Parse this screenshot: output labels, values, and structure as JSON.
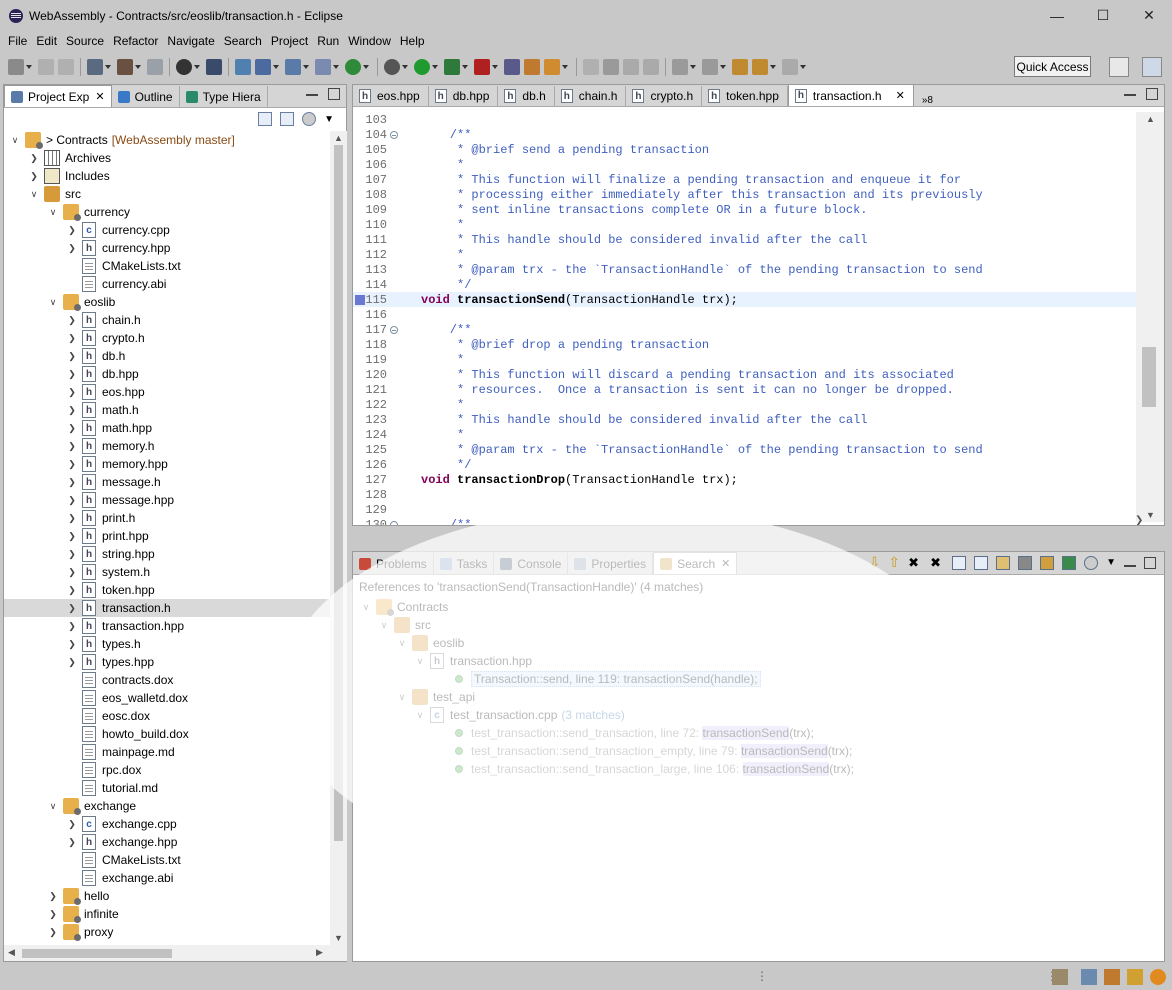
{
  "window": {
    "title": "WebAssembly - Contracts/src/eoslib/transaction.h - Eclipse"
  },
  "menu": [
    "File",
    "Edit",
    "Source",
    "Refactor",
    "Navigate",
    "Search",
    "Project",
    "Run",
    "Window",
    "Help"
  ],
  "toolbar": {
    "quick_access": "Quick Access"
  },
  "left_view": {
    "tabs": [
      "Project Exp",
      "Outline",
      "Type Hiera"
    ],
    "tree": [
      {
        "depth": 0,
        "twisty": "v",
        "icon": "project",
        "label": "> Contracts",
        "extra": "[WebAssembly master]"
      },
      {
        "depth": 1,
        "twisty": ">",
        "icon": "archive",
        "label": "Archives"
      },
      {
        "depth": 1,
        "twisty": ">",
        "icon": "includes",
        "label": "Includes"
      },
      {
        "depth": 1,
        "twisty": "v",
        "icon": "src",
        "label": "src"
      },
      {
        "depth": 2,
        "twisty": "v",
        "icon": "folder",
        "label": "currency"
      },
      {
        "depth": 3,
        "twisty": ">",
        "icon": "cfile",
        "label": "currency.cpp"
      },
      {
        "depth": 3,
        "twisty": ">",
        "icon": "hfile",
        "label": "currency.hpp"
      },
      {
        "depth": 3,
        "twisty": "",
        "icon": "txt",
        "label": "CMakeLists.txt"
      },
      {
        "depth": 3,
        "twisty": "",
        "icon": "txt",
        "label": "currency.abi"
      },
      {
        "depth": 2,
        "twisty": "v",
        "icon": "folder",
        "label": "eoslib"
      },
      {
        "depth": 3,
        "twisty": ">",
        "icon": "hfile",
        "label": "chain.h"
      },
      {
        "depth": 3,
        "twisty": ">",
        "icon": "hfile",
        "label": "crypto.h"
      },
      {
        "depth": 3,
        "twisty": ">",
        "icon": "hfile",
        "label": "db.h"
      },
      {
        "depth": 3,
        "twisty": ">",
        "icon": "hfile",
        "label": "db.hpp"
      },
      {
        "depth": 3,
        "twisty": ">",
        "icon": "hfile",
        "label": "eos.hpp"
      },
      {
        "depth": 3,
        "twisty": ">",
        "icon": "hfile",
        "label": "math.h"
      },
      {
        "depth": 3,
        "twisty": ">",
        "icon": "hfile",
        "label": "math.hpp"
      },
      {
        "depth": 3,
        "twisty": ">",
        "icon": "hfile",
        "label": "memory.h"
      },
      {
        "depth": 3,
        "twisty": ">",
        "icon": "hfile",
        "label": "memory.hpp"
      },
      {
        "depth": 3,
        "twisty": ">",
        "icon": "hfile",
        "label": "message.h"
      },
      {
        "depth": 3,
        "twisty": ">",
        "icon": "hfile",
        "label": "message.hpp"
      },
      {
        "depth": 3,
        "twisty": ">",
        "icon": "hfile",
        "label": "print.h"
      },
      {
        "depth": 3,
        "twisty": ">",
        "icon": "hfile",
        "label": "print.hpp"
      },
      {
        "depth": 3,
        "twisty": ">",
        "icon": "hfile",
        "label": "string.hpp"
      },
      {
        "depth": 3,
        "twisty": ">",
        "icon": "hfile",
        "label": "system.h"
      },
      {
        "depth": 3,
        "twisty": ">",
        "icon": "hfile",
        "label": "token.hpp"
      },
      {
        "depth": 3,
        "twisty": ">",
        "icon": "hfile",
        "label": "transaction.h",
        "selected": true
      },
      {
        "depth": 3,
        "twisty": ">",
        "icon": "hfile",
        "label": "transaction.hpp"
      },
      {
        "depth": 3,
        "twisty": ">",
        "icon": "hfile",
        "label": "types.h"
      },
      {
        "depth": 3,
        "twisty": ">",
        "icon": "hfile",
        "label": "types.hpp"
      },
      {
        "depth": 3,
        "twisty": "",
        "icon": "txt",
        "label": "contracts.dox"
      },
      {
        "depth": 3,
        "twisty": "",
        "icon": "txt",
        "label": "eos_walletd.dox"
      },
      {
        "depth": 3,
        "twisty": "",
        "icon": "txt",
        "label": "eosc.dox"
      },
      {
        "depth": 3,
        "twisty": "",
        "icon": "txt",
        "label": "howto_build.dox"
      },
      {
        "depth": 3,
        "twisty": "",
        "icon": "txt",
        "label": "mainpage.md"
      },
      {
        "depth": 3,
        "twisty": "",
        "icon": "txt",
        "label": "rpc.dox"
      },
      {
        "depth": 3,
        "twisty": "",
        "icon": "txt",
        "label": "tutorial.md"
      },
      {
        "depth": 2,
        "twisty": "v",
        "icon": "folder",
        "label": "exchange"
      },
      {
        "depth": 3,
        "twisty": ">",
        "icon": "cfile",
        "label": "exchange.cpp"
      },
      {
        "depth": 3,
        "twisty": ">",
        "icon": "hfile",
        "label": "exchange.hpp"
      },
      {
        "depth": 3,
        "twisty": "",
        "icon": "txt",
        "label": "CMakeLists.txt"
      },
      {
        "depth": 3,
        "twisty": "",
        "icon": "txt",
        "label": "exchange.abi"
      },
      {
        "depth": 2,
        "twisty": ">",
        "icon": "folder",
        "label": "hello"
      },
      {
        "depth": 2,
        "twisty": ">",
        "icon": "folder",
        "label": "infinite"
      },
      {
        "depth": 2,
        "twisty": ">",
        "icon": "folder",
        "label": "proxy"
      }
    ]
  },
  "editor": {
    "tabs": [
      "eos.hpp",
      "db.hpp",
      "db.h",
      "chain.h",
      "crypto.h",
      "token.hpp",
      "transaction.h"
    ],
    "active_tab": "transaction.h",
    "overflow": "»8",
    "lines": [
      {
        "n": "103",
        "fold": false,
        "text": ""
      },
      {
        "n": "104",
        "fold": true,
        "text": "    /**"
      },
      {
        "n": "105",
        "fold": false,
        "text": "     * @brief send a pending transaction"
      },
      {
        "n": "106",
        "fold": false,
        "text": "     *"
      },
      {
        "n": "107",
        "fold": false,
        "text": "     * This function will finalize a pending transaction and enqueue it for"
      },
      {
        "n": "108",
        "fold": false,
        "text": "     * processing either immediately after this transaction and its previously"
      },
      {
        "n": "109",
        "fold": false,
        "text": "     * sent inline transactions complete OR in a future block."
      },
      {
        "n": "110",
        "fold": false,
        "text": "     *"
      },
      {
        "n": "111",
        "fold": false,
        "text": "     * This handle should be considered invalid after the call"
      },
      {
        "n": "112",
        "fold": false,
        "text": "     *"
      },
      {
        "n": "113",
        "fold": false,
        "text": "     * @param trx - the `TransactionHandle` of the pending transaction to send"
      },
      {
        "n": "114",
        "fold": false,
        "text": "     */"
      },
      {
        "n": "115",
        "fold": false,
        "code": true,
        "kw": "void",
        "fn": "transactionSend",
        "rest": "(TransactionHandle trx);",
        "hl": true
      },
      {
        "n": "116",
        "fold": false,
        "text": ""
      },
      {
        "n": "117",
        "fold": true,
        "text": "    /**"
      },
      {
        "n": "118",
        "fold": false,
        "text": "     * @brief drop a pending transaction"
      },
      {
        "n": "119",
        "fold": false,
        "text": "     *"
      },
      {
        "n": "120",
        "fold": false,
        "text": "     * This function will discard a pending transaction and its associated"
      },
      {
        "n": "121",
        "fold": false,
        "text": "     * resources.  Once a transaction is sent it can no longer be dropped."
      },
      {
        "n": "122",
        "fold": false,
        "text": "     *"
      },
      {
        "n": "123",
        "fold": false,
        "text": "     * This handle should be considered invalid after the call"
      },
      {
        "n": "124",
        "fold": false,
        "text": "     *"
      },
      {
        "n": "125",
        "fold": false,
        "text": "     * @param trx - the `TransactionHandle` of the pending transaction to send"
      },
      {
        "n": "126",
        "fold": false,
        "text": "     */"
      },
      {
        "n": "127",
        "fold": false,
        "code": true,
        "kw": "void",
        "fn": "transactionDrop",
        "rest": "(TransactionHandle trx);"
      },
      {
        "n": "128",
        "fold": false,
        "text": ""
      },
      {
        "n": "129",
        "fold": false,
        "text": ""
      },
      {
        "n": "130",
        "fold": true,
        "text": "    /**"
      }
    ]
  },
  "bottom_view": {
    "tabs": [
      "Problems",
      "Tasks",
      "Console",
      "Properties",
      "Search"
    ],
    "active_tab": "Search",
    "header": "References to 'transactionSend(TransactionHandle)' (4 matches)",
    "results": {
      "project": "Contracts",
      "src": "src",
      "eoslib": "eoslib",
      "file1": "transaction.hpp",
      "r1_ctx": "Transaction::send, line 119:",
      "r1_match": "transactionSend",
      "r1_rest": "(handle);",
      "test_api": "test_api",
      "file2": "test_transaction.cpp",
      "file2_count": "(3 matches)",
      "r2_ctx": "test_transaction::send_transaction, line 72:",
      "r2_match": "transactionSend",
      "r2_rest": "(trx);",
      "r3_ctx": "test_transaction::send_transaction_empty, line 79:",
      "r3_match": "transactionSend",
      "r3_rest": "(trx);",
      "r4_ctx": "test_transaction::send_transaction_large, line 106:",
      "r4_match": "transactionSend",
      "r4_rest": "(trx);"
    }
  },
  "colors": {
    "chrome": "#c8c8c8",
    "match_highlight": "#cdc7f2",
    "line_highlight": "#e8f2fe",
    "comment": "#3f5fbf",
    "keyword": "#7f0055"
  }
}
